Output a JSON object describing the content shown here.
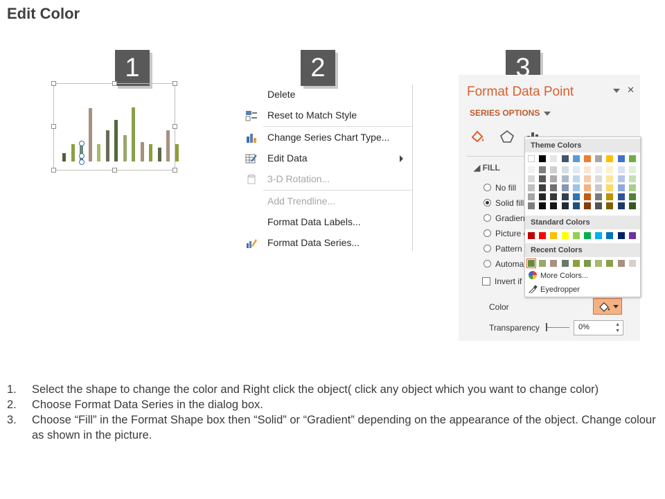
{
  "page": {
    "title": "Edit Color"
  },
  "steps": {
    "step1": "1",
    "step2": "2",
    "step3": "3"
  },
  "mini_chart": {
    "bars": [
      {
        "h": 0.12,
        "color": "#4f5f3b"
      },
      {
        "h": 0.25,
        "color": "#8c9f3c"
      },
      {
        "h": 0.28,
        "color": "#6d8a7a"
      },
      {
        "h": 0.77,
        "color": "#a89080"
      },
      {
        "h": 0.25,
        "color": "#a8b86a"
      },
      {
        "h": 0.45,
        "color": "#6a6a5a"
      },
      {
        "h": 0.6,
        "color": "#4f6a3b"
      },
      {
        "h": 0.38,
        "color": "#9aa86a"
      },
      {
        "h": 0.78,
        "color": "#8a9f4c"
      },
      {
        "h": 0.28,
        "color": "#a89080"
      },
      {
        "h": 0.25,
        "color": "#8c9f3c"
      },
      {
        "h": 0.2,
        "color": "#5a6a4a"
      },
      {
        "h": 0.45,
        "color": "#a89080"
      },
      {
        "h": 0.25,
        "color": "#8c9f3c"
      }
    ]
  },
  "context_menu": {
    "items": [
      {
        "label": "Delete",
        "enabled": true,
        "icon": "none"
      },
      {
        "label": "Reset to Match Style",
        "enabled": true,
        "icon": "reset-style-icon"
      },
      {
        "label": "Change Series Chart Type...",
        "enabled": true,
        "icon": "chart-type-icon"
      },
      {
        "label": "Edit Data",
        "enabled": true,
        "icon": "edit-data-icon",
        "submenu": true
      },
      {
        "label": "3-D Rotation...",
        "enabled": false,
        "icon": "rotation-icon"
      },
      {
        "label": "Add Trendline...",
        "enabled": false,
        "icon": "none"
      },
      {
        "label": "Format Data Labels...",
        "enabled": true,
        "icon": "none"
      },
      {
        "label": "Format Data Series...",
        "enabled": true,
        "icon": "format-series-icon"
      }
    ]
  },
  "format_pane": {
    "title": "Format Data Point",
    "series_options": "SERIES OPTIONS",
    "fill_header": "FILL",
    "options": [
      "No fill",
      "Solid fill",
      "Gradient",
      "Picture o",
      "Pattern f",
      "Automa"
    ],
    "selected_option": "Solid fill",
    "invert": "Invert if",
    "color_label": "Color",
    "transparency_label": "Transparency",
    "transparency_value": "0%",
    "accent_color": "#d9602f"
  },
  "palette": {
    "theme_colors_label": "Theme Colors",
    "standard_colors_label": "Standard Colors",
    "recent_colors_label": "Recent Colors",
    "more_colors": "More Colors...",
    "eyedropper": "Eyedropper",
    "theme_top": [
      "#ffffff",
      "#000000",
      "#e7e6e6",
      "#44546a",
      "#5b9bd5",
      "#ed7d31",
      "#a5a5a5",
      "#ffc000",
      "#4472c4",
      "#70ad47"
    ],
    "theme_shades": [
      [
        "#f2f2f2",
        "#7f7f7f",
        "#d0cece",
        "#d6dce4",
        "#deebf6",
        "#fbe5d5",
        "#ededed",
        "#fff2cc",
        "#dae3f3",
        "#e2efd9"
      ],
      [
        "#d8d8d8",
        "#595959",
        "#aeabab",
        "#adb9ca",
        "#bdd7ee",
        "#f7cbac",
        "#dbdbdb",
        "#fee599",
        "#b4c6e7",
        "#c5e0b3"
      ],
      [
        "#bfbfbf",
        "#3f3f3f",
        "#757070",
        "#8496b0",
        "#9dc3e6",
        "#f4b183",
        "#c9c9c9",
        "#ffd965",
        "#8eaadb",
        "#a8d08d"
      ],
      [
        "#a5a5a5",
        "#262626",
        "#3a3838",
        "#323f4f",
        "#2e75b5",
        "#c55a11",
        "#7b7b7b",
        "#bf9000",
        "#2f5496",
        "#538135"
      ],
      [
        "#7f7f7f",
        "#0c0c0c",
        "#171616",
        "#222a35",
        "#1f4e79",
        "#833c0b",
        "#525252",
        "#7f6000",
        "#1f3864",
        "#375623"
      ]
    ],
    "standard": [
      "#c00000",
      "#ff0000",
      "#ffc000",
      "#ffff00",
      "#92d050",
      "#00b050",
      "#00b0f0",
      "#0070c0",
      "#002060",
      "#7030a0"
    ],
    "recent": [
      "#6a8a3a",
      "#9aa86a",
      "#a89080",
      "#6a7a6a",
      "#8c9f3c",
      "#7a9a4a",
      "#a8b86a",
      "#8a9f4c",
      "#a89080",
      "#d9cfc8"
    ]
  },
  "instructions": [
    {
      "num": "1.",
      "text": "Select the shape to change the color and Right click the object( click any object which you want to change color)"
    },
    {
      "num": "2.",
      "text": "Choose Format Data Series in the dialog box."
    },
    {
      "num": "3.",
      "text": "Choose “Fill” in the Format Shape box then “Solid” or “Gradient” depending on the appearance of the object. Change colour as shown in the picture."
    }
  ]
}
